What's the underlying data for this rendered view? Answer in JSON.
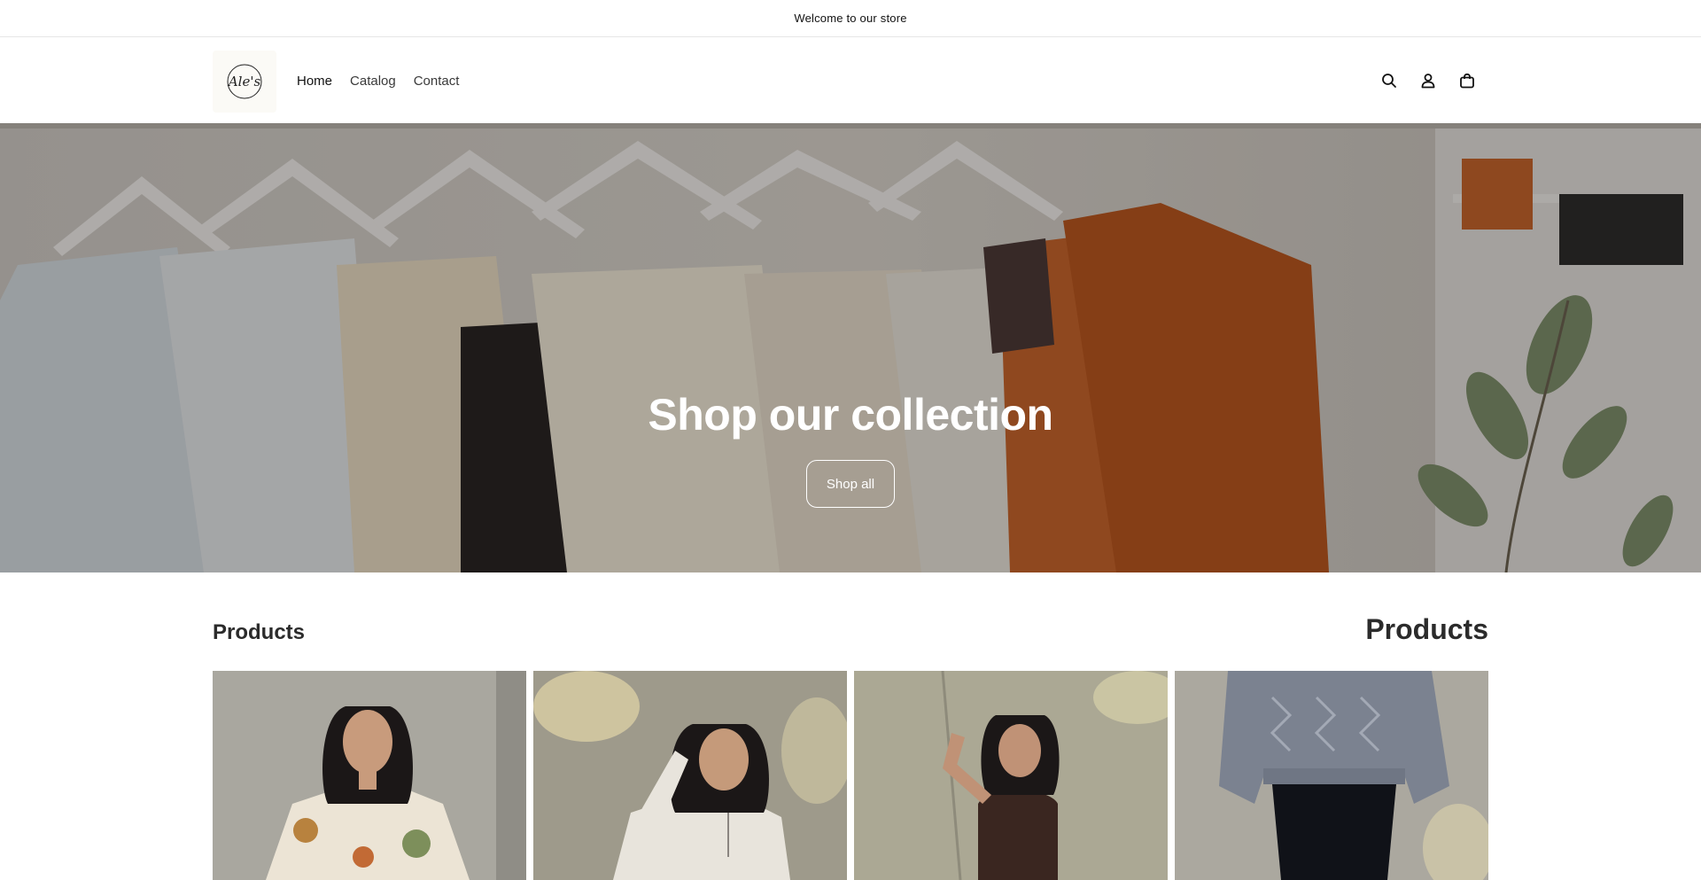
{
  "announcement": {
    "text": "Welcome to our store"
  },
  "header": {
    "logo_text": "Ale's",
    "nav": [
      {
        "label": "Home"
      },
      {
        "label": "Catalog"
      },
      {
        "label": "Contact"
      }
    ],
    "icons": [
      "search-icon",
      "account-icon",
      "cart-icon"
    ]
  },
  "hero": {
    "title": "Shop our collection",
    "button_label": "Shop all"
  },
  "products_section": {
    "title_left": "Products",
    "title_right": "Products",
    "cards": [
      {
        "image": "woman-in-paisley-blouse"
      },
      {
        "image": "woman-in-cream-half-zip-sweater"
      },
      {
        "image": "woman-in-brown-knit-tank"
      },
      {
        "image": "grey-cable-knit-sweater-on-model"
      }
    ]
  },
  "colors": {
    "accent": "#121212",
    "background": "#ffffff",
    "terracotta": "#b5531f"
  }
}
